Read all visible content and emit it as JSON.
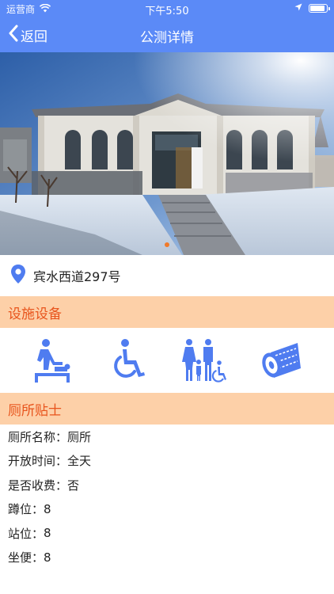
{
  "status_bar": {
    "carrier": "运营商",
    "time": "下午5:50",
    "battery_level": 0.95
  },
  "nav": {
    "back_label": "返回",
    "title": "公测详情"
  },
  "carousel": {
    "page_count": 1,
    "active_index": 0
  },
  "address": {
    "text": "宾水西道297号",
    "icon": "location-pin-icon"
  },
  "facilities": {
    "header": "设施设备",
    "items": [
      {
        "icon": "baby-changing-icon"
      },
      {
        "icon": "wheelchair-icon"
      },
      {
        "icon": "family-restroom-icon"
      },
      {
        "icon": "toilet-paper-icon"
      }
    ]
  },
  "tips": {
    "header": "厕所贴士",
    "rows": [
      {
        "label": "厕所名称：",
        "value": "厕所"
      },
      {
        "label": "开放时间：",
        "value": "全天"
      },
      {
        "label": "是否收费：",
        "value": "否"
      },
      {
        "label": "蹲位：",
        "value": "8"
      },
      {
        "label": "站位：",
        "value": "8"
      },
      {
        "label": "坐便：",
        "value": "8"
      }
    ]
  },
  "colors": {
    "primary": "#5b8af7",
    "section_bg": "#fdd0a8",
    "section_text": "#e8541c",
    "icon_blue": "#4f7cf0",
    "carousel_dot_active": "#f07a2a"
  }
}
